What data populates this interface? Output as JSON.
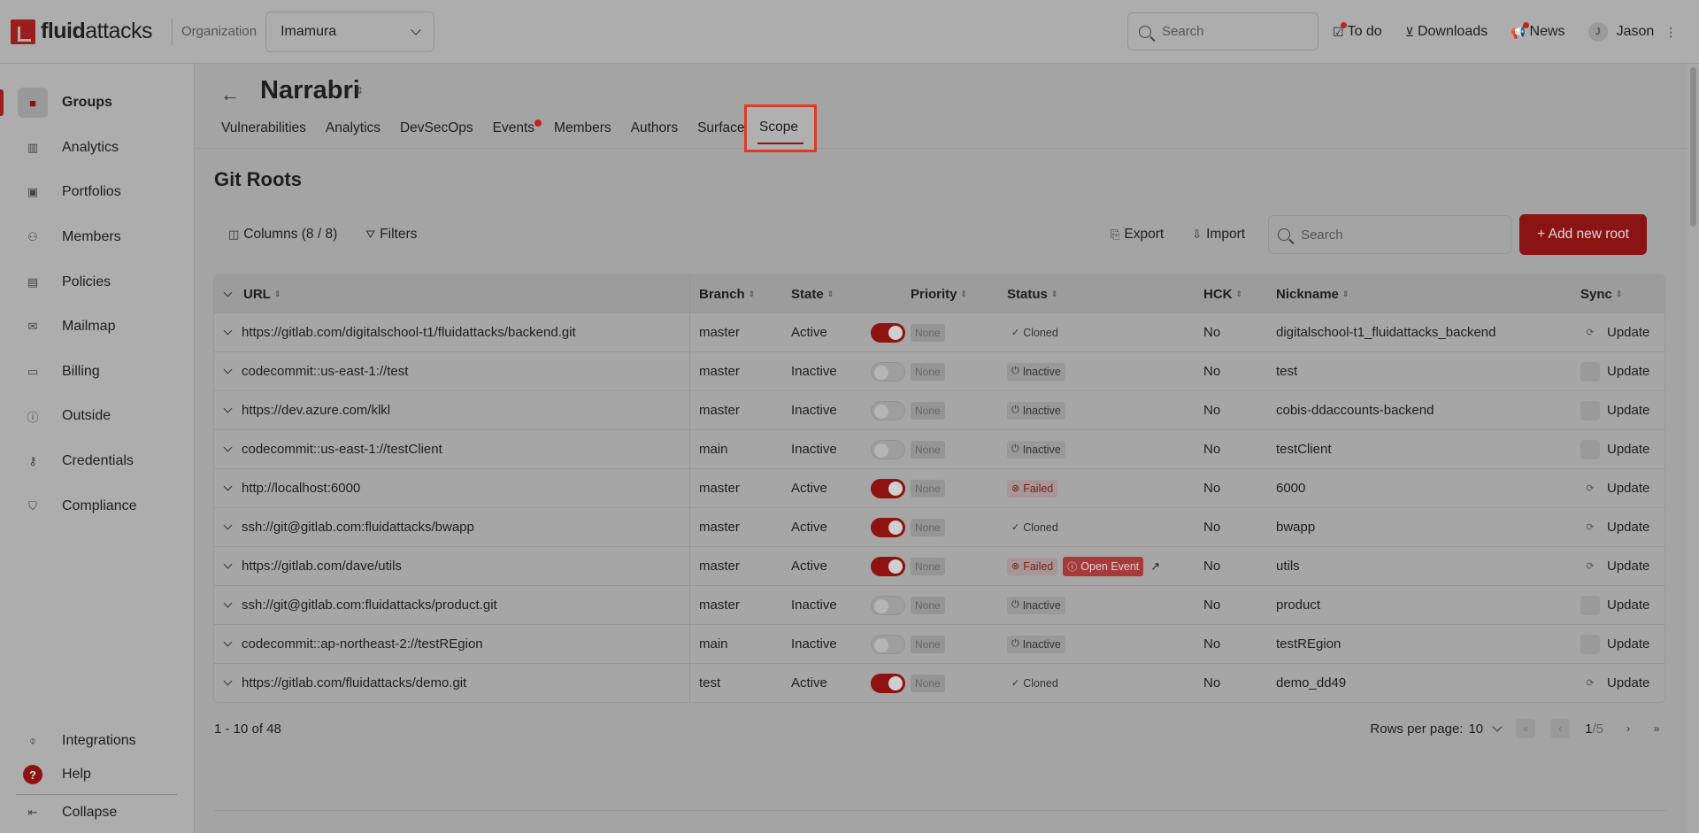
{
  "brand": {
    "logo_bold": "fluid",
    "logo_rest": "attacks"
  },
  "topbar": {
    "org_label": "Organization",
    "org_value": "Imamura",
    "search_placeholder": "Search",
    "todo": "To do",
    "downloads": "Downloads",
    "news": "News",
    "avatar_initial": "J",
    "user_name": "Jason"
  },
  "sidebar": {
    "items": [
      {
        "label": "Groups",
        "icon": "folder-icon"
      },
      {
        "label": "Analytics",
        "icon": "bar-chart-icon"
      },
      {
        "label": "Portfolios",
        "icon": "briefcase-icon"
      },
      {
        "label": "Members",
        "icon": "user-plus-icon"
      },
      {
        "label": "Policies",
        "icon": "policy-icon"
      },
      {
        "label": "Mailmap",
        "icon": "mail-icon"
      },
      {
        "label": "Billing",
        "icon": "billing-icon"
      },
      {
        "label": "Outside",
        "icon": "info-icon"
      },
      {
        "label": "Credentials",
        "icon": "key-icon"
      },
      {
        "label": "Compliance",
        "icon": "shield-icon"
      }
    ],
    "integrations": "Integrations",
    "help": "Help",
    "help_glyph": "?",
    "collapse": "Collapse"
  },
  "group": {
    "title": "Narrabri",
    "tabs": [
      "Vulnerabilities",
      "Analytics",
      "DevSecOps",
      "Events",
      "Members",
      "Authors",
      "Surface"
    ],
    "active_tab": "Scope"
  },
  "section": {
    "title": "Git Roots",
    "columns_btn": "Columns (8 / 8)",
    "filters_btn": "Filters",
    "export_btn": "Export",
    "import_btn": "Import",
    "search_placeholder": "Search",
    "add_btn": "+ Add new root"
  },
  "table": {
    "headers": {
      "url": "URL",
      "branch": "Branch",
      "state": "State",
      "priority": "Priority",
      "status": "Status",
      "hck": "HCK",
      "nickname": "Nickname",
      "sync": "Sync"
    },
    "rows": [
      {
        "url": "https://gitlab.com/digitalschool-t1/fluidattacks/backend.git",
        "branch": "master",
        "state": "Active",
        "priority": "None",
        "status": "Cloned",
        "event": "",
        "hck": "No",
        "nickname": "digitalschool-t1_fluidattacks_backend",
        "sync": "Update"
      },
      {
        "url": "codecommit::us-east-1://test",
        "branch": "master",
        "state": "Inactive",
        "priority": "None",
        "status": "Inactive",
        "event": "",
        "hck": "No",
        "nickname": "test",
        "sync": "Update"
      },
      {
        "url": "https://dev.azure.com/klkl",
        "branch": "master",
        "state": "Inactive",
        "priority": "None",
        "status": "Inactive",
        "event": "",
        "hck": "No",
        "nickname": "cobis-ddaccounts-backend",
        "sync": "Update"
      },
      {
        "url": "codecommit::us-east-1://testClient",
        "branch": "main",
        "state": "Inactive",
        "priority": "None",
        "status": "Inactive",
        "event": "",
        "hck": "No",
        "nickname": "testClient",
        "sync": "Update"
      },
      {
        "url": "http://localhost:6000",
        "branch": "master",
        "state": "Active",
        "priority": "None",
        "status": "Failed",
        "event": "",
        "hck": "No",
        "nickname": "6000",
        "sync": "Update"
      },
      {
        "url": "ssh://git@gitlab.com:fluidattacks/bwapp",
        "branch": "master",
        "state": "Active",
        "priority": "None",
        "status": "Cloned",
        "event": "",
        "hck": "No",
        "nickname": "bwapp",
        "sync": "Update"
      },
      {
        "url": "https://gitlab.com/dave/utils",
        "branch": "master",
        "state": "Active",
        "priority": "None",
        "status": "Failed",
        "event": "Open Event",
        "hck": "No",
        "nickname": "utils",
        "sync": "Update"
      },
      {
        "url": "ssh://git@gitlab.com:fluidattacks/product.git",
        "branch": "master",
        "state": "Inactive",
        "priority": "None",
        "status": "Inactive",
        "event": "",
        "hck": "No",
        "nickname": "product",
        "sync": "Update"
      },
      {
        "url": "codecommit::ap-northeast-2://testREgion",
        "branch": "main",
        "state": "Inactive",
        "priority": "None",
        "status": "Inactive",
        "event": "",
        "hck": "No",
        "nickname": "testREgion",
        "sync": "Update"
      },
      {
        "url": "https://gitlab.com/fluidattacks/demo.git",
        "branch": "test",
        "state": "Active",
        "priority": "None",
        "status": "Cloned",
        "event": "",
        "hck": "No",
        "nickname": "demo_dd49",
        "sync": "Update"
      }
    ]
  },
  "pagination": {
    "range": "1 - 10 of 48",
    "rows_label": "Rows per page:",
    "rows_value": "10",
    "current": "1",
    "total": "/5"
  },
  "colors": {
    "accent": "#8a1313",
    "highlight_box": "#e03a26"
  }
}
